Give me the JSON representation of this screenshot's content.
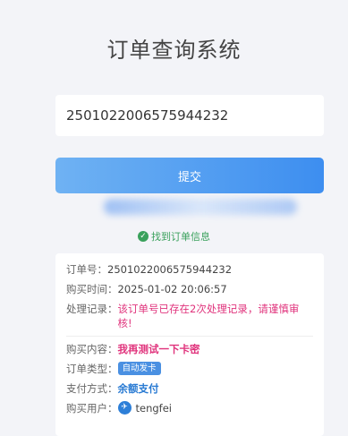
{
  "page": {
    "title": "订单查询系统"
  },
  "search": {
    "value": "2501022006575944232"
  },
  "submit": {
    "label": "提交"
  },
  "status": {
    "found_text": "找到订单信息"
  },
  "order": {
    "number_label": "订单号：",
    "number": "2501022006575944232",
    "time_label": "购买时间：",
    "time": "2025-01-02 20:06:57",
    "record_label": "处理记录：",
    "record": "该订单号已存在2次处理记录，请谨慎审核!",
    "content_label": "购买内容：",
    "content": "我再测试一下卡密",
    "type_label": "订单类型：",
    "type": "自动发卡",
    "payment_label": "支付方式：",
    "payment": "余额支付",
    "user_label": "购买用户：",
    "user": "tengfei"
  },
  "colors": {
    "accent": "#3d8ef0",
    "success": "#3aa15c",
    "warning": "#e0337c"
  }
}
